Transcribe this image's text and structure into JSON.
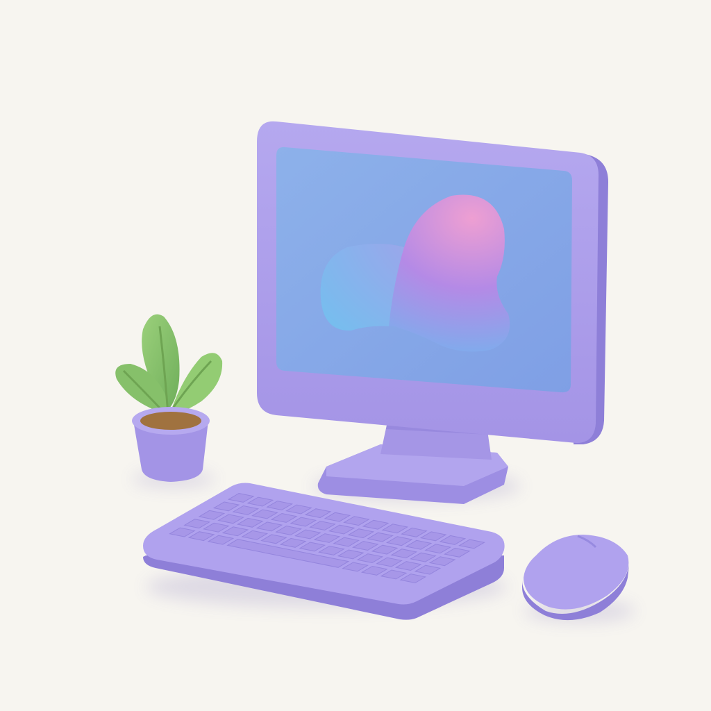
{
  "scene": {
    "objects": [
      "plant",
      "monitor",
      "keyboard",
      "mouse"
    ]
  },
  "palette": {
    "background": "#f7f5f0",
    "device_body": "#a99ae8",
    "device_light": "#b6a9ef",
    "device_shadow": "#8d7fd6",
    "screen": "#86aae8",
    "blob_blue": "#7cc3ef",
    "blob_violet": "#a887e8",
    "blob_pink": "#e99bd3",
    "leaf_green": "#8cc46e",
    "soil": "#a0723f"
  }
}
